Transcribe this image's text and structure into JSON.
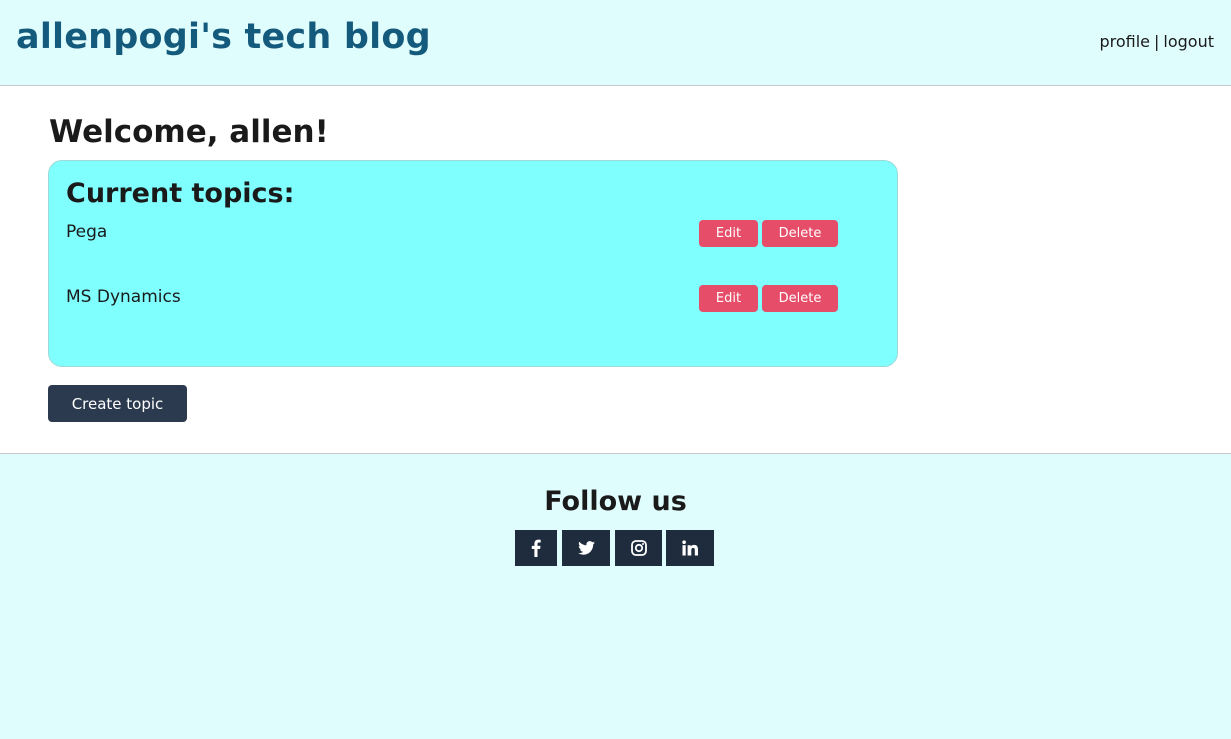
{
  "header": {
    "site_title": "allenpogi's tech blog",
    "nav": {
      "profile_label": "profile",
      "separator": "|",
      "logout_label": "logout"
    }
  },
  "main": {
    "welcome": "Welcome, allen!",
    "topics_heading": "Current topics:",
    "topics": [
      {
        "name": "Pega",
        "edit_label": "Edit",
        "delete_label": "Delete"
      },
      {
        "name": "MS Dynamics",
        "edit_label": "Edit",
        "delete_label": "Delete"
      }
    ],
    "create_label": "Create topic"
  },
  "footer": {
    "follow_title": "Follow us",
    "social": [
      {
        "icon": "facebook-icon"
      },
      {
        "icon": "twitter-icon"
      },
      {
        "icon": "instagram-icon"
      },
      {
        "icon": "linkedin-icon"
      }
    ]
  },
  "colors": {
    "header_bg": "#e0fdfe",
    "title": "#145a7c",
    "card_bg": "#80ffff",
    "action_red": "#e54d68",
    "dark_button": "#2b3a4e",
    "social_bg": "#1f2c3d"
  }
}
